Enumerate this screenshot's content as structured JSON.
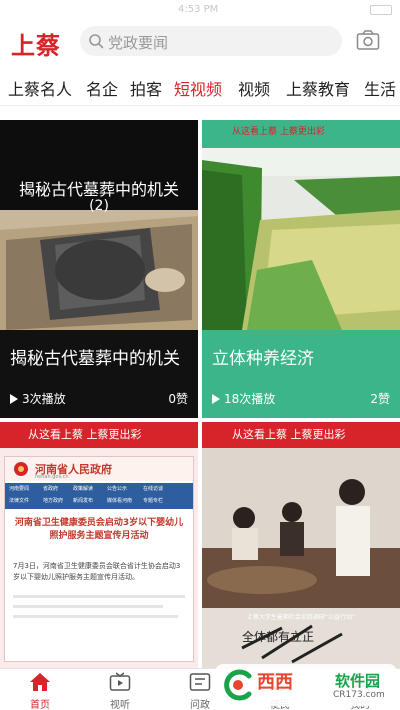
{
  "status": {
    "time": "4:53 PM"
  },
  "header": {
    "logo": "上蔡",
    "search_placeholder": "党政要闻",
    "accent": "#d7242a"
  },
  "tabs": [
    {
      "label": "上蔡名人",
      "active": false
    },
    {
      "label": "名企",
      "active": false
    },
    {
      "label": "拍客",
      "active": false
    },
    {
      "label": "短视频",
      "active": true
    },
    {
      "label": "视频",
      "active": false
    },
    {
      "label": "上蔡教育",
      "active": false
    },
    {
      "label": "生活",
      "active": false
    }
  ],
  "cards": [
    {
      "image_heading": "揭秘古代墓葬中的机关",
      "image_sub": "(2)",
      "title": "揭秘古代墓葬中的机关",
      "plays": "3次播放",
      "likes": "0赞",
      "bottom_color": "#111111"
    },
    {
      "title": "立体种养经济",
      "plays": "18次播放",
      "likes": "2赞",
      "banner": "从这看上蔡 上蔡更出彩",
      "bottom_color": "#3db58a"
    },
    {
      "banner": "从这看上蔡 上蔡更出彩",
      "gov_site": "河南省人民政府",
      "gov_domain": "henan.gov.cn",
      "gov_nav": [
        "河南要闻",
        "省政府",
        "政策解读",
        "公告公示",
        "在线访谈",
        "法律文件",
        "地方政府",
        "新闻发布",
        "媒体看河南",
        "专题专栏"
      ],
      "headline": "河南省卫生健康委员会启动3岁以下婴幼儿照护服务主题宣传月活动",
      "body": "7月3日，河南省卫生健康委员会联合省计生协会启动3岁以下婴幼儿照护服务主题宣传月活动。"
    },
    {
      "banner": "从这看上蔡 上蔡更出彩",
      "overlay_text": "全体都有立正",
      "caption": "上蔡大学生暑期社会实践调研“公益行动”"
    }
  ],
  "bottom_nav": [
    {
      "label": "首页",
      "icon": "home-icon",
      "active": true
    },
    {
      "label": "视听",
      "icon": "tv-icon",
      "active": false
    },
    {
      "label": "问政",
      "icon": "government-icon",
      "active": false
    },
    {
      "label": "便民",
      "icon": "service-icon",
      "active": false
    },
    {
      "label": "我的",
      "icon": "user-icon",
      "active": false
    }
  ],
  "watermark": {
    "name": "西西",
    "sub": "软件园",
    "url": "CR173.com"
  }
}
